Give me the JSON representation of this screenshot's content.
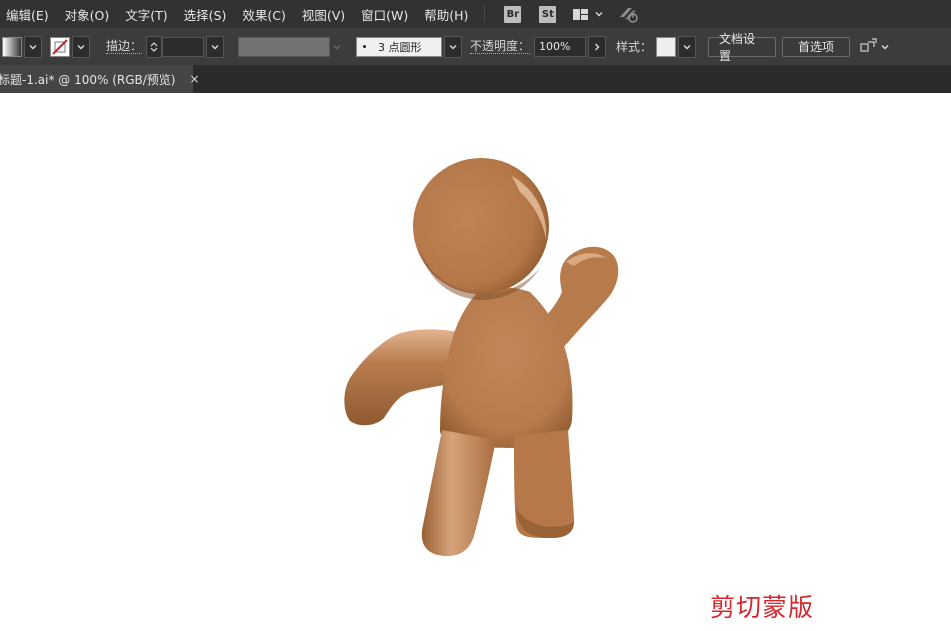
{
  "menubar": {
    "items": [
      "编辑(E)",
      "对象(O)",
      "文字(T)",
      "选择(S)",
      "效果(C)",
      "视图(V)",
      "窗口(W)",
      "帮助(H)"
    ],
    "br_label": "Br",
    "st_label": "St"
  },
  "control": {
    "stroke_label": "描边：",
    "brush_value": "3 点圆形",
    "opacity_label": "不透明度：",
    "opacity_value": "100%",
    "style_label": "样式：",
    "doc_setup_label": "文档设置",
    "preferences_label": "首选项"
  },
  "tab": {
    "title": "标题-1.ai* @ 100% (RGB/预览)",
    "close": "×"
  },
  "canvas": {
    "caption": "剪切蒙版",
    "figure_color": "#b87a4a"
  }
}
